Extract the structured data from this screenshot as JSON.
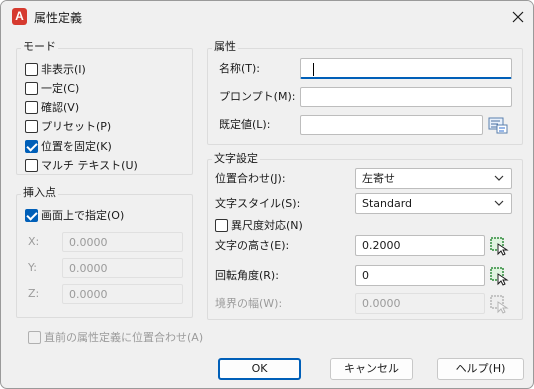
{
  "window": {
    "title": "属性定義",
    "app_icon_letter": "A"
  },
  "mode": {
    "title": "モード",
    "items": [
      {
        "label": "非表示(I)",
        "checked": false
      },
      {
        "label": "一定(C)",
        "checked": false
      },
      {
        "label": "確認(V)",
        "checked": false
      },
      {
        "label": "プリセット(P)",
        "checked": false
      },
      {
        "label": "位置を固定(K)",
        "checked": true
      },
      {
        "label": "マルチ テキスト(U)",
        "checked": false
      }
    ]
  },
  "insertion": {
    "title": "挿入点",
    "specify_onscreen": {
      "label": "画面上で指定(O)",
      "checked": true
    },
    "x_label": "X:",
    "x_value": "0.0000",
    "y_label": "Y:",
    "y_value": "0.0000",
    "z_label": "Z:",
    "z_value": "0.0000"
  },
  "attribute": {
    "title": "属性",
    "tag_label": "名称(T):",
    "tag_value": "",
    "prompt_label": "プロンプト(M):",
    "prompt_value": "",
    "default_label": "既定値(L):",
    "default_value": "",
    "insert_field_icon": "insert-field-icon"
  },
  "text_settings": {
    "title": "文字設定",
    "justification_label": "位置合わせ(J):",
    "justification_value": "左寄せ",
    "style_label": "文字スタイル(S):",
    "style_value": "Standard",
    "annotative": {
      "label": "異尺度対応(N)",
      "checked": false
    },
    "height_label": "文字の高さ(E):",
    "height_value": "0.2000",
    "rotation_label": "回転角度(R):",
    "rotation_value": "0",
    "boundary_label": "境界の幅(W):",
    "boundary_value": "0.0000",
    "pick_icon": "pick-point-icon"
  },
  "align_below": {
    "label": "直前の属性定義に位置合わせ(A)",
    "checked": false
  },
  "buttons": {
    "ok": "OK",
    "cancel": "キャンセル",
    "help": "ヘルプ(H)"
  },
  "colors": {
    "accent": "#005fb8",
    "app_icon": "#d63a2f",
    "dialog_bg": "#f0f0f0"
  }
}
